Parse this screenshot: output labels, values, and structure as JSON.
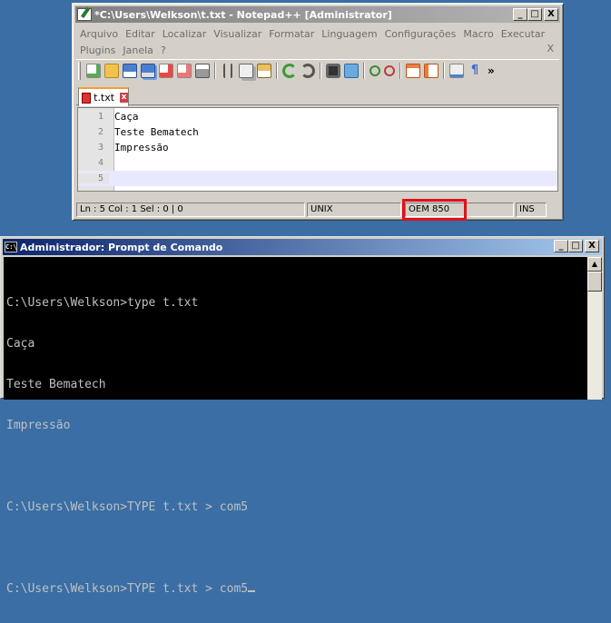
{
  "notepad": {
    "title": "*C:\\Users\\Welkson\\t.txt - Notepad++ [Administrator]",
    "menu_row1": [
      "Arquivo",
      "Editar",
      "Localizar",
      "Visualizar",
      "Formatar",
      "Linguagem",
      "Configurações",
      "Macro",
      "Executar"
    ],
    "menu_row2": [
      "Plugins",
      "Janela",
      "?"
    ],
    "menu_close": "X",
    "toolbar_more": "»",
    "tab": {
      "label": "t.txt",
      "close": "x"
    },
    "lines": [
      {
        "num": "1",
        "text": "Caça"
      },
      {
        "num": "2",
        "text": "Teste Bematech"
      },
      {
        "num": "3",
        "text": "Impressão"
      },
      {
        "num": "4",
        "text": ""
      },
      {
        "num": "5",
        "text": ""
      }
    ],
    "status": {
      "position": "Ln : 5    Col : 1    Sel : 0 | 0",
      "eol": "UNIX",
      "encoding": "OEM 850",
      "mode": "INS"
    }
  },
  "cmd": {
    "title": "Administrador: Prompt de Comando",
    "icon_text": "C:\\",
    "lines": [
      "C:\\Users\\Welkson>type t.txt",
      "Caça",
      "Teste Bematech",
      "Impressão",
      "",
      "C:\\Users\\Welkson>TYPE t.txt > com5",
      "",
      "C:\\Users\\Welkson>TYPE t.txt > com5"
    ]
  },
  "window_buttons": {
    "minimize": "_",
    "maximize": "□",
    "close": "X"
  },
  "colors": {
    "highlight": "#e0101a",
    "desktop": "#3a6ea5"
  }
}
